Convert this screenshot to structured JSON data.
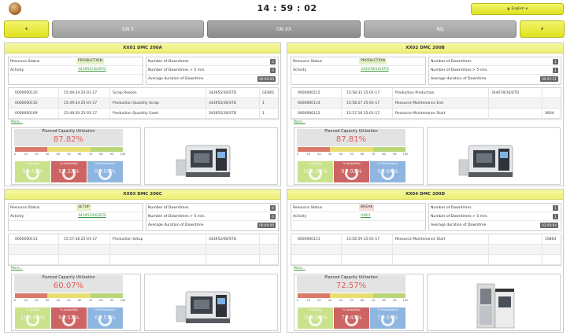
{
  "header": {
    "clock": "14 : 59 : 02",
    "language": "English"
  },
  "nav": {
    "prev": "‹",
    "next": "›",
    "tabs": [
      "GN 5",
      "GN XX",
      "NQ"
    ]
  },
  "labels": {
    "resource_status": "Resource Status",
    "activity": "Activity",
    "num_downtimes": "Number of Downtimes",
    "num_downtimes_5": "Number of Downtimes > 5 min.",
    "avg_downtime": "Average duration of Downtime",
    "more": "More...",
    "pcu": "Planned Capacity Utilization",
    "quality": "% Quality",
    "availability": "% Availability",
    "performance": "% Performance"
  },
  "axis_ticks": [
    "0",
    "10",
    "20",
    "30",
    "40",
    "50",
    "60",
    "70",
    "80",
    "90",
    "100"
  ],
  "colors": {
    "accent_yellow": "#ecef72",
    "status_ok": "#e5f2c8",
    "status_warn": "#f6dbd6",
    "link_green": "#37963c",
    "kpi_red": "#e35a5a",
    "quality_tile": "#cbe28d",
    "availability_tile": "#cc6464",
    "performance_tile": "#8fb6e0"
  },
  "machines": [
    {
      "title": "XX01 DMC 200A",
      "status": "PRODUCTION",
      "status_level": "ok",
      "activity": "343955/30/STD",
      "downtimes": "0",
      "downtimes_5": "0",
      "avg_duration": "00:00:00",
      "log": [
        {
          "id": "0000000110",
          "time": "15:49:34 25-01-17",
          "event": "Scrap Reason",
          "order": "343955/30/STD",
          "extra": "GEN01"
        },
        {
          "id": "0000000110",
          "time": "15:49:34 25-01-17",
          "event": "Production Quantity Scrap",
          "order": "343955/30/STD",
          "extra": "1"
        },
        {
          "id": "0000000109",
          "time": "15:49:20 25-01-17",
          "event": "Production Quantity Good",
          "order": "343955/30/STD",
          "extra": "1"
        }
      ],
      "pcu_value": "87.82%",
      "quality": "99.42%",
      "availability": "92.32%",
      "performance": "91.05%",
      "machine_icon": "machining-center-image"
    },
    {
      "title": "XX02 DMC 200B",
      "status": "PRODUCTION",
      "status_level": "ok",
      "activity": "344078/10/STD",
      "downtimes": "1",
      "downtimes_5": "1",
      "avg_duration": "00:01:11",
      "log": [
        {
          "id": "0000000115",
          "time": "15:58:33 25-01-17",
          "event": "Production Production",
          "order": "344078/10/STD",
          "extra": ""
        },
        {
          "id": "0000000114",
          "time": "15:58:27 25-01-17",
          "event": "Resource Maintenance End",
          "order": "",
          "extra": ""
        },
        {
          "id": "0000000112",
          "time": "15:57:16 25-01-17",
          "event": "Resource Maintenance Start",
          "order": "",
          "extra": "3604"
        }
      ],
      "pcu_value": "87.81%",
      "quality": "100.00%",
      "availability": "97.92%",
      "performance": "91.68%",
      "machine_icon": "machining-center-image"
    },
    {
      "title": "XX03 DMC 200C",
      "status": "SETUP",
      "status_level": "ok",
      "activity": "343952/60/STD",
      "downtimes": "0",
      "downtimes_5": "0",
      "avg_duration": "00:00:00",
      "log": [
        {
          "id": "0000000113",
          "time": "15:57:38 25-01-17",
          "event": "Production Setup",
          "order": "343952/60/STD",
          "extra": ""
        },
        {
          "id": "",
          "time": "",
          "event": "",
          "order": "",
          "extra": ""
        },
        {
          "id": "",
          "time": "",
          "event": "",
          "order": "",
          "extra": ""
        }
      ],
      "pcu_value": "60.07%",
      "quality": "100.00%",
      "availability": "97.52%",
      "performance": "61.53%",
      "machine_icon": "machining-center-image"
    },
    {
      "title": "XX04 DMC 200D",
      "status": "BREAK",
      "status_level": "warn",
      "activity": "UN01",
      "downtimes": "1",
      "downtimes_5": "1",
      "avg_duration": "02:00:04",
      "log": [
        {
          "id": "0000000111",
          "time": "15:56:59 25-01-17",
          "event": "Resource Maintenance Start",
          "order": "",
          "extra": "10804"
        },
        {
          "id": "",
          "time": "",
          "event": "",
          "order": "",
          "extra": ""
        },
        {
          "id": "",
          "time": "",
          "event": "",
          "order": "",
          "extra": ""
        }
      ],
      "pcu_value": "72.57%",
      "quality": "100.00%",
      "availability": "72.43%",
      "performance": "76.04%",
      "machine_icon": "vertical-machine-image"
    }
  ]
}
